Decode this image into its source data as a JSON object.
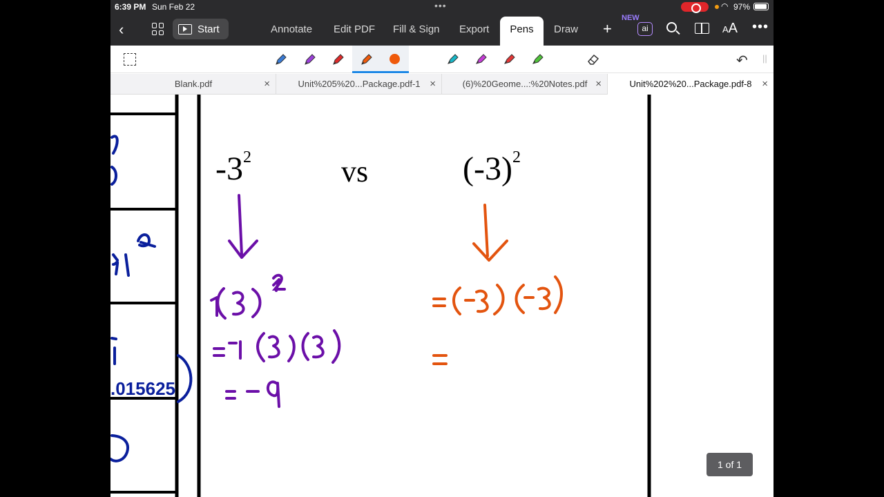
{
  "status_bar": {
    "time": "6:39 PM",
    "date": "Sun Feb 22",
    "battery": "97%"
  },
  "toolbar": {
    "start_label": "Start",
    "tabs": [
      "Annotate",
      "Edit PDF",
      "Fill & Sign",
      "Export",
      "Pens",
      "Draw"
    ],
    "active_tab": "Pens",
    "ai_new_badge": "NEW",
    "ai_label": "ai",
    "text_size_label": "AA"
  },
  "pens": {
    "tools": [
      {
        "icon": "pen-blue-icon",
        "color": "#3a7bd5"
      },
      {
        "icon": "pen-purple-icon",
        "color": "#9b3fd9"
      },
      {
        "icon": "pen-red-icon",
        "color": "#e02a2a"
      },
      {
        "icon": "pen-orange-icon",
        "color": "#ef5a0b"
      },
      {
        "icon": "highlighter-cyan-icon",
        "color": "#18b8c8"
      },
      {
        "icon": "highlighter-magenta-icon",
        "color": "#c53dd6"
      },
      {
        "icon": "highlighter-red-icon",
        "color": "#e33636"
      },
      {
        "icon": "highlighter-green-icon",
        "color": "#4fc43a"
      }
    ],
    "active_color": "#ef5a0b"
  },
  "doc_tabs": [
    {
      "name": "Blank.pdf",
      "active": false
    },
    {
      "name": "Unit%205%20...Package.pdf-1",
      "active": false
    },
    {
      "name": "(6)%20Geome...:%20Notes.pdf",
      "active": false
    },
    {
      "name": "Unit%202%20...Package.pdf-8",
      "active": true
    }
  ],
  "document": {
    "left_expr": "-3",
    "left_exp": "2",
    "vs": "vs",
    "right_expr": "(-3)",
    "right_exp": "2",
    "ink_colors": {
      "purple": "#6b0fa8",
      "orange": "#e3540f",
      "blue": "#0a1f9c"
    }
  },
  "page_indicator": "1 of 1"
}
